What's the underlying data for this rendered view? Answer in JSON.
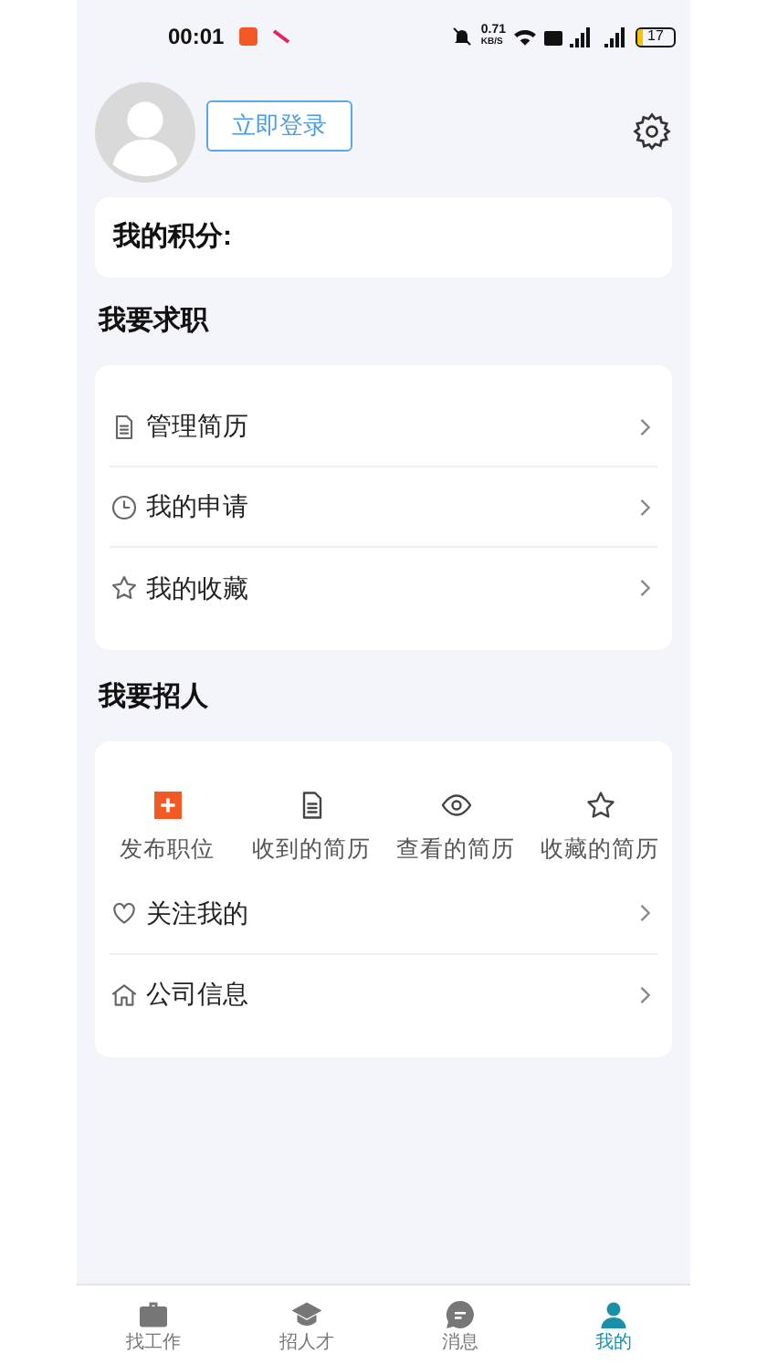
{
  "status_bar": {
    "time": "00:01",
    "speed": "0.71",
    "speed_unit": "KB/S",
    "battery": "17"
  },
  "profile": {
    "login_button": "立即登录"
  },
  "points": {
    "label": "我的积分:"
  },
  "job_seeking": {
    "title": "我要求职",
    "items": [
      {
        "kind": "document",
        "label": "管理简历"
      },
      {
        "kind": "clock",
        "label": "我的申请"
      },
      {
        "kind": "star",
        "label": "我的收藏"
      }
    ]
  },
  "recruiting": {
    "title": "我要招人",
    "shortcuts": [
      {
        "kind": "plus",
        "label": "发布职位"
      },
      {
        "kind": "document",
        "label": "收到的简历"
      },
      {
        "kind": "eye",
        "label": "查看的简历"
      },
      {
        "kind": "star",
        "label": "收藏的简历"
      }
    ],
    "items": [
      {
        "kind": "heart",
        "label": "关注我的"
      },
      {
        "kind": "home",
        "label": "公司信息"
      }
    ]
  },
  "tabs": [
    {
      "kind": "briefcase",
      "label": "找工作",
      "selected": false
    },
    {
      "kind": "cap",
      "label": "招人才",
      "selected": false
    },
    {
      "kind": "chat",
      "label": "消息",
      "selected": false
    },
    {
      "kind": "person",
      "label": "我的",
      "selected": true
    }
  ]
}
